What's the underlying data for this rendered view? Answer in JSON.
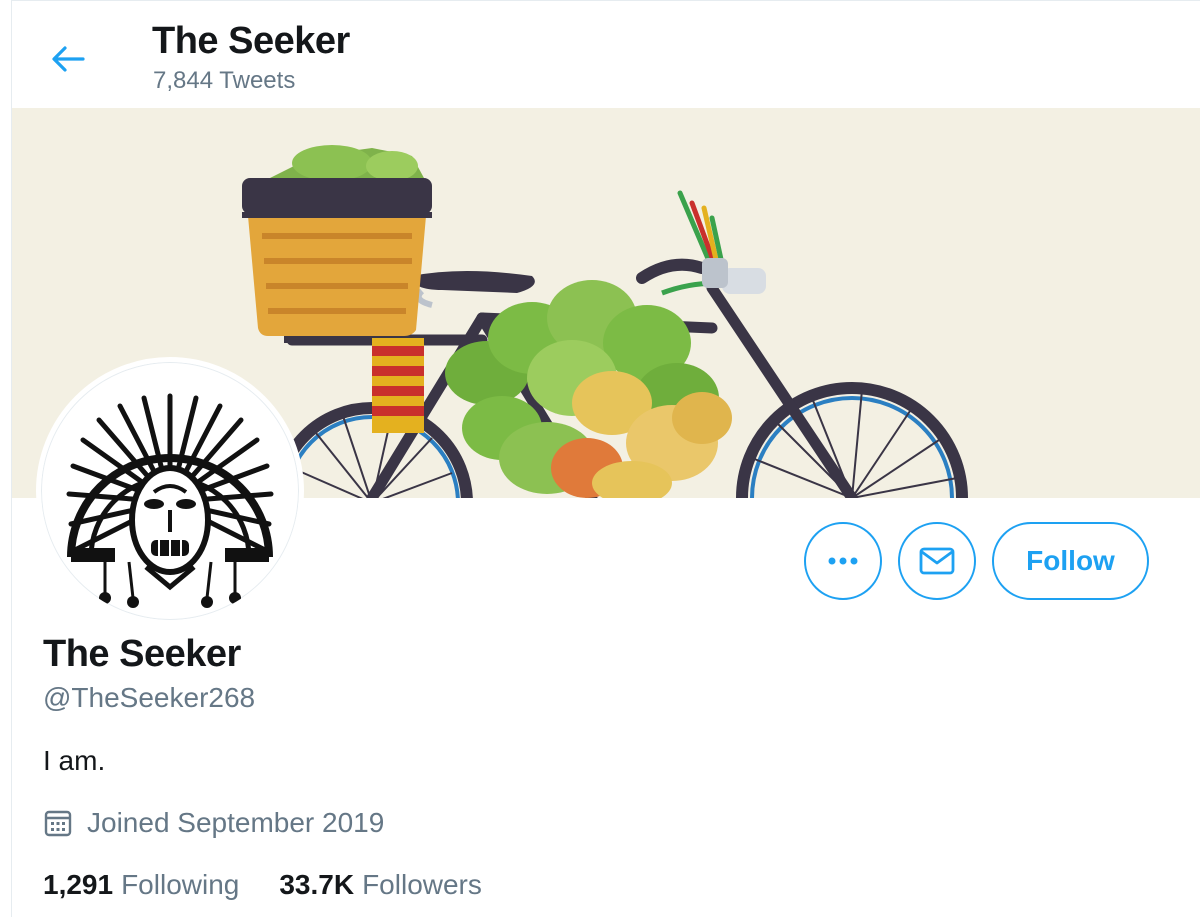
{
  "header": {
    "title": "The Seeker",
    "tweet_count": "7,844 Tweets",
    "back_icon": "arrow-left-icon"
  },
  "profile": {
    "name": "The Seeker",
    "handle": "@TheSeeker268",
    "bio": "I am.",
    "joined": "Joined September 2019",
    "following_count": "1,291",
    "following_label": "Following",
    "followers_count": "33.7K",
    "followers_label": "Followers"
  },
  "actions": {
    "more_icon": "more-dots-icon",
    "message_icon": "envelope-icon",
    "follow_label": "Follow"
  },
  "colors": {
    "accent": "#1da1f2",
    "secondary_text": "#657786",
    "banner_bg": "#f3f0e3"
  }
}
